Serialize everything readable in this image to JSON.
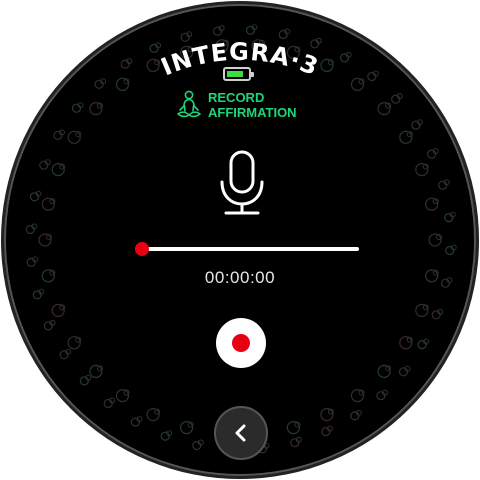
{
  "brand": {
    "name": "INTEGRA·3"
  },
  "status": {
    "battery_icon": "battery-full-icon",
    "battery_color": "#3ddc3d"
  },
  "mode": {
    "icon": "meditation-person-icon",
    "line1": "RECORD",
    "line2": "AFFIRMATION",
    "color": "#1fd47a"
  },
  "recorder": {
    "mic_icon": "microphone-icon",
    "elapsed": "00:00:00",
    "progress": 0.03,
    "record_icon": "record-dot-icon",
    "record_color": "#e60012"
  },
  "nav": {
    "back_icon": "chevron-left-icon"
  }
}
